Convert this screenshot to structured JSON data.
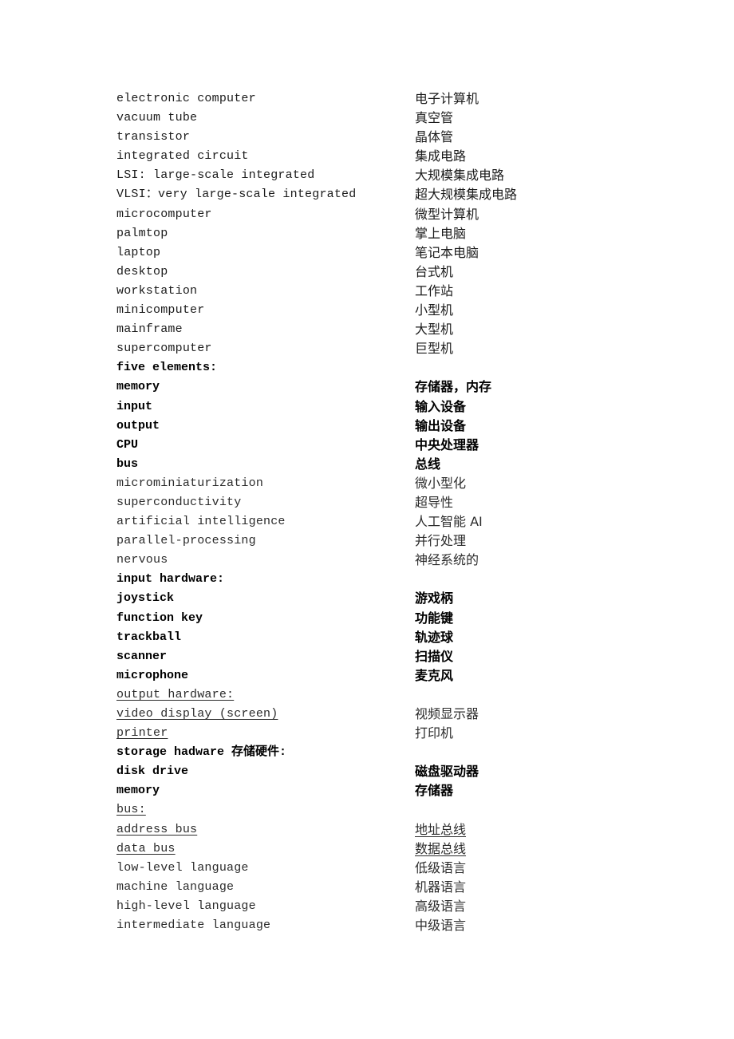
{
  "document": {
    "rows": [
      {
        "en": "electronic computer",
        "zh": "电子计算机"
      },
      {
        "en": "vacuum tube",
        "zh": "真空管"
      },
      {
        "en": "transistor",
        "zh": "晶体管"
      },
      {
        "en": "integrated circuit",
        "zh": "集成电路"
      },
      {
        "en": "LSI: large-scale integrated",
        "zh": "大规模集成电路"
      },
      {
        "en": "VLSI：very large-scale integrated",
        "zh": "超大规模集成电路"
      },
      {
        "en": "microcomputer",
        "zh": "微型计算机"
      },
      {
        "en": "palmtop",
        "zh": "掌上电脑"
      },
      {
        "en": "laptop",
        "zh": "笔记本电脑"
      },
      {
        "en": "desktop",
        "zh": "台式机"
      },
      {
        "en": "workstation",
        "zh": "工作站"
      },
      {
        "en": "minicomputer",
        "zh": "小型机"
      },
      {
        "en": "mainframe",
        "zh": "大型机"
      },
      {
        "en": "supercomputer",
        "zh": "巨型机"
      },
      {
        "en": "five elements:",
        "zh": ""
      },
      {
        "en": "memory",
        "zh": "存储器，内存"
      },
      {
        "en": "input",
        "zh": "输入设备"
      },
      {
        "en": "output",
        "zh": "输出设备"
      },
      {
        "en": "CPU",
        "zh": "中央处理器"
      },
      {
        "en": "bus",
        "zh": "总线"
      },
      {
        "en": "microminiaturization",
        "zh": "微小型化"
      },
      {
        "en": "superconductivity",
        "zh": "超导性"
      },
      {
        "en": "artificial intelligence",
        "zh": "人工智能 AI"
      },
      {
        "en": "parallel-processing",
        "zh": "并行处理"
      },
      {
        "en": "nervous",
        "zh": "神经系统的"
      },
      {
        "en": "input hardware:",
        "zh": ""
      },
      {
        "en": "joystick",
        "zh": "游戏柄"
      },
      {
        "en": "function key",
        "zh": "功能键"
      },
      {
        "en": "trackball",
        "zh": "轨迹球"
      },
      {
        "en": "scanner",
        "zh": "扫描仪"
      },
      {
        "en": "microphone",
        "zh": "麦克风"
      },
      {
        "en": "output hardware:",
        "zh": ""
      },
      {
        "en": "video display (screen)",
        "zh": "视频显示器"
      },
      {
        "en": "printer",
        "zh": "打印机"
      },
      {
        "en": "storage hadware 存储硬件:",
        "zh": ""
      },
      {
        "en": "disk drive",
        "zh": "磁盘驱动器"
      },
      {
        "en": "memory",
        "zh": "存储器"
      },
      {
        "en": "bus:",
        "zh": ""
      },
      {
        "en": "address bus",
        "zh": "地址总线"
      },
      {
        "en": "data bus",
        "zh": "数据总线"
      },
      {
        "en": "low-level language",
        "zh": "低级语言"
      },
      {
        "en": "machine language",
        "zh": "机器语言"
      },
      {
        "en": "high-level language",
        "zh": "高级语言"
      },
      {
        "en": "intermediate language",
        "zh": "中级语言"
      }
    ]
  }
}
